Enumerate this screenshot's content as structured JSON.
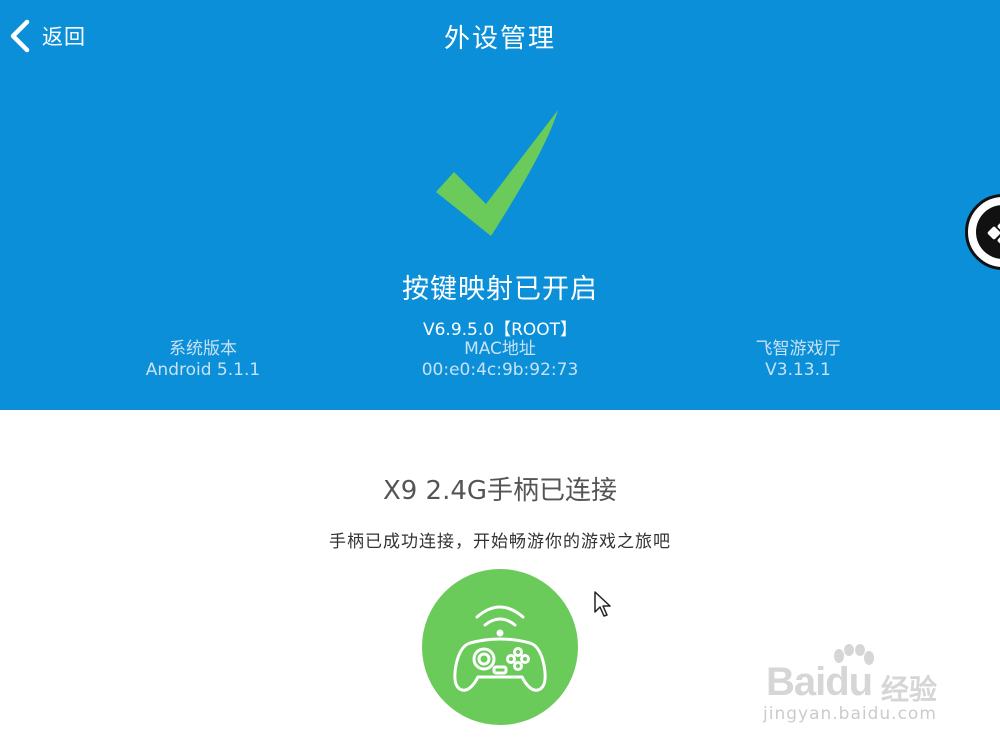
{
  "header": {
    "back_label": "返回",
    "title": "外设管理",
    "background_color": "#0a8fd8"
  },
  "status": {
    "icon": "checkmark-icon",
    "icon_color": "#6acb5a",
    "text": "按键映射已开启",
    "version": "V6.9.5.0【ROOT】"
  },
  "info": {
    "system": {
      "label": "系统版本",
      "value": "Android 5.1.1"
    },
    "mac": {
      "label": "MAC地址",
      "value": "00:e0:4c:9b:92:73"
    },
    "app": {
      "label": "飞智游戏厅",
      "value": "V3.13.1"
    }
  },
  "floating_button": {
    "icon": "gamepad-dpad-icon"
  },
  "device": {
    "title": "X9 2.4G手柄已连接",
    "subtitle": "手柄已成功连接，开始畅游你的游戏之旅吧",
    "icon": "wireless-gamepad-icon",
    "circle_color": "#6acb5a"
  },
  "watermark": {
    "brand": "Baidu",
    "cn": "经验",
    "url": "jingyan.baidu.com"
  }
}
